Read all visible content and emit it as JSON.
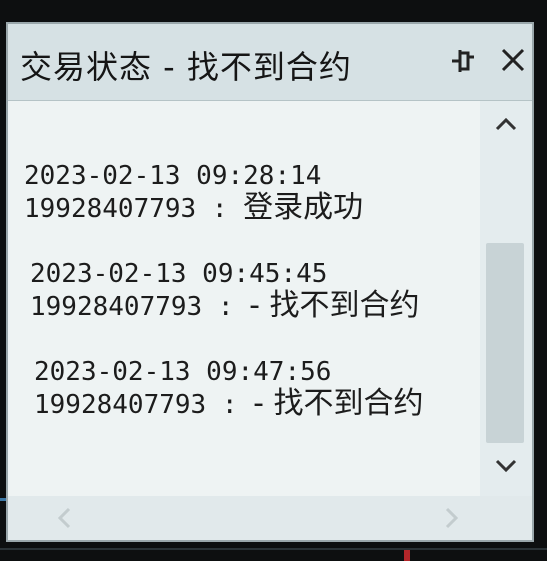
{
  "window": {
    "title": "交易状态 - 找不到合约"
  },
  "entries": [
    {
      "timestamp": "2023-02-13 09:28:14",
      "account": "19928407793 :",
      "message": "登录成功"
    },
    {
      "timestamp": "2023-02-13 09:45:45",
      "account": "19928407793 :",
      "message": " - 找不到合约"
    },
    {
      "timestamp": "2023-02-13 09:47:56",
      "account": "19928407793 :",
      "message": " - 找不到合约"
    }
  ],
  "icons": {
    "pin": "pin-icon",
    "close": "close-icon",
    "scroll_up": "chevron-up-icon",
    "scroll_down": "chevron-down-icon",
    "scroll_left": "chevron-left-icon",
    "scroll_right": "chevron-right-icon"
  },
  "colors": {
    "titlebar": "#d6e1e4",
    "content_background": "#eef3f3",
    "text": "#1c1c1c"
  }
}
